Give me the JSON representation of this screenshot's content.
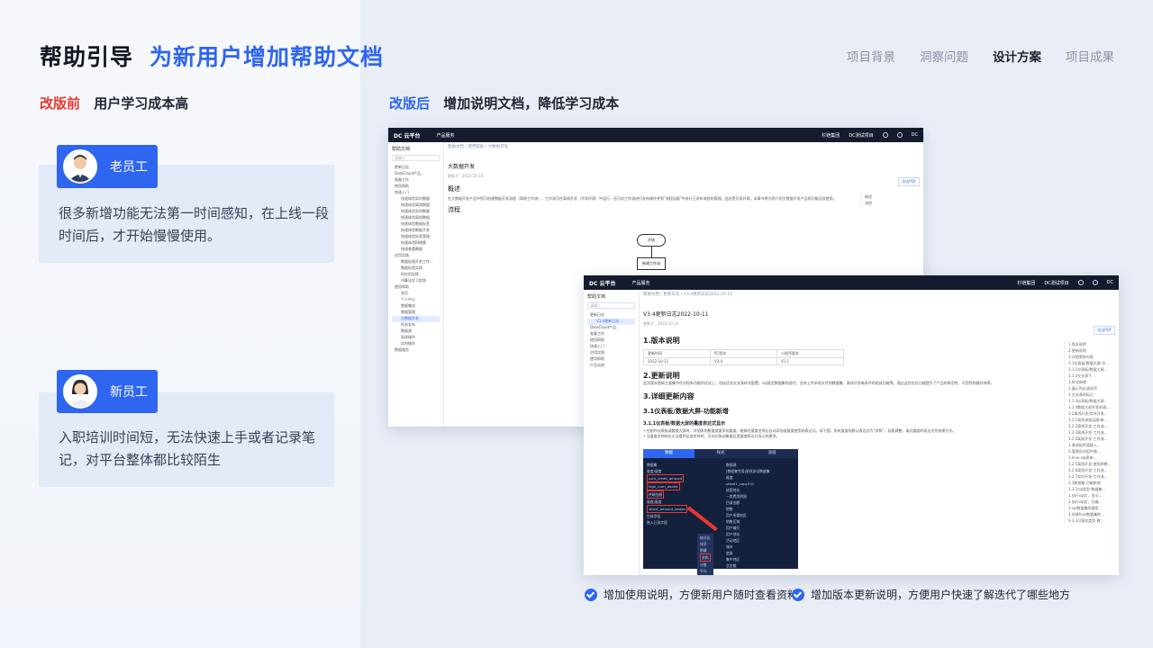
{
  "header": {
    "title": "帮助引导",
    "subtitle": "为新用户增加帮助文档",
    "nav": [
      "项目背景",
      "洞察问题",
      "设计方案",
      "项目成果"
    ],
    "nav_active": "设计方案"
  },
  "before": {
    "tag": "改版前",
    "text": "用户学习成本高",
    "personas": [
      {
        "name": "老员工",
        "desc": "很多新增功能无法第一时间感知，在上线一段时间后，才开始慢慢使用。"
      },
      {
        "name": "新员工",
        "desc": "入职培训时间短，无法快速上手或者记录笔记，对平台整体都比较陌生"
      }
    ]
  },
  "after": {
    "tag": "改版后",
    "text": "增加说明文档，降低学习成本"
  },
  "screenshot1": {
    "logo": "DC 云平台",
    "product_menu": "产品服务",
    "org": "杉铠集团",
    "project": "DC测试项目",
    "avatar": "DC",
    "sidebar_title": "帮助文档",
    "search_placeholder": "请输入",
    "sidebar_items": [
      "更新日志",
      "DataCloud产品...",
      "准备工作",
      "使用帮助",
      "快速入门",
      "快速体验实时数据",
      "快速体验离线数据",
      "快速体验实时数据",
      "快速体验离线数据",
      "快速体验数据标签",
      "快速体验数据开发",
      "快速体验标签管理",
      "快速体验BI建模",
      "快速查看数据",
      "应用实践",
      "数据处理开发工作...",
      "数据标签实践",
      "BI应用实践",
      "AI算法学习实践",
      "使用帮助",
      "首页",
      "个人中心",
      "数据集成",
      "数据管理",
      "大数据开发",
      "任务发布",
      "数据源",
      "离线操作",
      "实时操作",
      "数据服务"
    ],
    "breadcrumb": "帮助文档 / 使用帮助 / 大数据开发",
    "doc_title": "大数据开发",
    "doc_meta": "更新于：2022-10-16",
    "export": "导出PDF",
    "section_overview": "概述",
    "overview_text": "在大数据开发产品中您可创建数据开发流程（简称工作流），工作流可在离线开发（开发环境）中运行，还可对工作流进行发布操作并到\"流程运维\"中进行已发布流程的管理。此处是开发环境，本章节将为您介绍大数据开发产品的功能及其使用。",
    "section_flow": "流程",
    "toc": [
      "概述",
      "流程"
    ],
    "flow_start": "开始",
    "flow_step": "新建工作流"
  },
  "screenshot2": {
    "logo": "DC 云平台",
    "product_menu": "产品服务",
    "org": "杉铠集团",
    "project": "DC测试项目",
    "avatar": "DC",
    "sidebar_title": "帮助文档",
    "search_placeholder": "请输入",
    "sidebar_items": [
      "更新日志",
      "V3.4更新日志...",
      "DataCloud产品...",
      "准备工作",
      "使用帮助",
      "快速入门",
      "应用实践",
      "使用帮助",
      "产品动态"
    ],
    "breadcrumb": "帮助文档 / 更新日志 / V3.4更新日志2022-10-11",
    "doc_title": "V3.4更新日志2022-10-11",
    "doc_meta": "更新于：2022-10-10",
    "export": "导出PDF",
    "h_version": "1.版本说明",
    "table_headers": [
      "更新时间",
      "PC版本",
      "小程序版本"
    ],
    "table_row": [
      "2022-10-11",
      "V3.4",
      "V1.1"
    ],
    "h_update": "2.更新说明",
    "update_text": "此次版本更新主要集中在对现有功能的优化上，包括优化交叉表样式配置、sql类型数据集的迭代、支持上传本地文件到数据集、离线开发每条件的组成功能等。通过这些优化功能提升了产品的易用性、可用性和操作效率。",
    "h_detail": "3.详细更新内容",
    "h_dashboard": "3.1仪表板/数据大屏-功能新增",
    "h_sub": "3.1.1仪表板/数据大屏的量度表达式显示",
    "bullets": [
      "• 在制作仪表板或数据大屏时，对图表的数量度量添加量度，能够在量度名称后自动添加该量度使用的表达式。如下图，所有量度的默认表达式为\"求和\"，若要调整，请点量度的表达式并选择方式。",
      "• 当量度名称较长无法看到全部名称时，可向左拖动聚量区宽度使表达式显示的更多。"
    ],
    "dark_tabs": [
      "数据",
      "样式",
      "高级"
    ],
    "dark_tab_active": "数据",
    "dark_left": [
      "数据集",
      "维度/量度",
      "sum_credit_amount",
      "high_num_dealer",
      "终端金额",
      "量度/量度",
      "latest_amount_dealer",
      "生成字段",
      "拖入已选字段"
    ],
    "dark_right": [
      "数据源",
      "[数据集专用]更改测试数据集",
      "维度",
      "sheet1_copy331",
      "经营地址",
      "一类费用明细",
      "目录金额",
      "销售",
      "用户所需地区",
      "销售区域",
      "用户编号",
      "用户地址",
      "活动地区",
      "城市",
      "度量",
      "集中地区",
      "总金额"
    ],
    "dark_menu": [
      "格式化",
      "排序",
      "隐藏",
      "求和",
      "计数",
      "平均"
    ],
    "toc": [
      "1.版本说明",
      "2.更新说明",
      "3.详细更新内容",
      "3.1仪表板/数据大屏-功...",
      "3.1.1仪表板/数据大屏...",
      "3.1.2交叉表下...",
      "1.样式新增",
      "2.展示列过滤选项",
      "3.交叉表的标记",
      "3.1.3仪表板/数据大屏...",
      "3.1.4数据大屏并发的表...",
      "3.2离线开发/实时开发...",
      "3.2.1离线流程运维-新...",
      "3.2.2离线开发-工作流...",
      "3.2.3离线开发-工作流...",
      "3.2.4离线开发-工作流...",
      "1.查询组件值接入...",
      "2.管理员对组件操...",
      "3.hive sql表单...",
      "3.2.5离线开发-使用参数...",
      "3.2.6离线开发-工作流...",
      "3.2.7实时开发-工作流...",
      "3.3数据集-功能新增",
      "3.3.1sql类型-数据集...",
      "1.执行sql后，显示...",
      "2.执行sql后，在编...",
      "3.sql数据集的搜索...",
      "4.创建hive数据集的...",
      "3.3.2可视化类型-数..."
    ]
  },
  "footer": [
    "增加使用说明，方便新用户随时查看资料",
    "增加版本更新说明，方便用户快速了解迭代了哪些地方"
  ],
  "colors": {
    "brand": "#2f66f0",
    "alert": "#e8382f",
    "topbar": "#141b2d"
  }
}
